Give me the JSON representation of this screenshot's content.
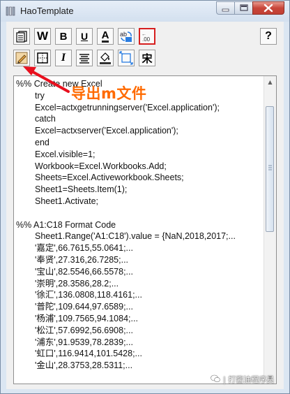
{
  "window": {
    "title": "HaoTemplate"
  },
  "toolbar": {
    "row1": [
      {
        "icon": "document-icon"
      },
      {
        "icon": "word-icon",
        "text": "W"
      },
      {
        "icon": "bold-icon",
        "text": "B"
      },
      {
        "icon": "underline-icon",
        "text": "U"
      },
      {
        "icon": "font-color-icon",
        "text": "A"
      },
      {
        "icon": "convert-icon",
        "text": "ab"
      },
      {
        "icon": "decimal-format-icon",
        "text": ".00"
      }
    ],
    "row2": [
      {
        "icon": "export-m-file-icon"
      },
      {
        "icon": "border-icon"
      },
      {
        "icon": "italic-icon",
        "text": "I"
      },
      {
        "icon": "align-icon"
      },
      {
        "icon": "fill-color-icon"
      },
      {
        "icon": "resize-icon"
      },
      {
        "icon": "chinese-font-icon",
        "text": "宋"
      }
    ],
    "help": {
      "text": "?"
    }
  },
  "editor": {
    "lines": [
      {
        "indent": 0,
        "text": "%% Create new Excel"
      },
      {
        "indent": 1,
        "text": "try"
      },
      {
        "indent": 1,
        "text": "Excel=actxgetrunningserver('Excel.application');"
      },
      {
        "indent": 1,
        "text": "catch"
      },
      {
        "indent": 1,
        "text": "Excel=actxserver('Excel.application');"
      },
      {
        "indent": 1,
        "text": "end"
      },
      {
        "indent": 1,
        "text": "Excel.visible=1;"
      },
      {
        "indent": 1,
        "text": "Workbook=Excel.Workbooks.Add;"
      },
      {
        "indent": 1,
        "text": "Sheets=Excel.Activeworkbook.Sheets;"
      },
      {
        "indent": 1,
        "text": "Sheet1=Sheets.Item(1);"
      },
      {
        "indent": 1,
        "text": "Sheet1.Activate;"
      },
      {
        "indent": 0,
        "text": ""
      },
      {
        "indent": 0,
        "text": "%% A1:C18 Format Code"
      },
      {
        "indent": 1,
        "text": "Sheet1.Range('A1:C18').value = {NaN,2018,2017;..."
      },
      {
        "indent": 1,
        "text": "'嘉定',66.7615,55.0641;..."
      },
      {
        "indent": 1,
        "text": "'奉贤',27.316,26.7285;..."
      },
      {
        "indent": 1,
        "text": "'宝山',82.5546,66.5578;..."
      },
      {
        "indent": 1,
        "text": "'崇明',28.3586,28.2;..."
      },
      {
        "indent": 1,
        "text": "'徐汇',136.0808,118.4161;..."
      },
      {
        "indent": 1,
        "text": "'普陀',109.644,97.6589;..."
      },
      {
        "indent": 1,
        "text": "'杨浦',109.7565,94.1084;..."
      },
      {
        "indent": 1,
        "text": "'松江',57.6992,56.6908;..."
      },
      {
        "indent": 1,
        "text": "'浦东',91.9539,78.2839;..."
      },
      {
        "indent": 1,
        "text": "'虹口',116.9414,101.5428;..."
      },
      {
        "indent": 1,
        "text": "'金山',28.3753,28.5311;..."
      }
    ]
  },
  "annotation": {
    "text": "导出m文件",
    "color": "#ff6a00"
  },
  "watermark": {
    "text": "| 打酱油程序员"
  }
}
